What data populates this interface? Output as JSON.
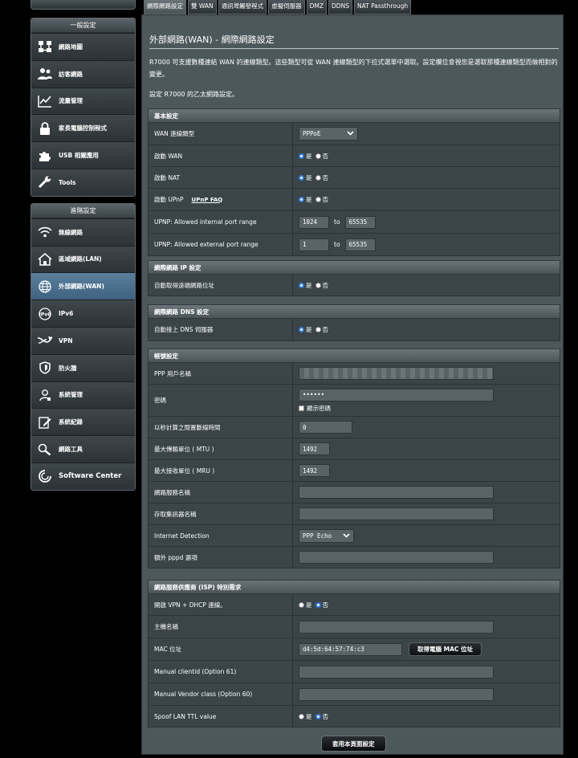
{
  "sidebar": {
    "general_title": "一般設定",
    "general_items": [
      {
        "label": "網路地圖"
      },
      {
        "label": "訪客網路"
      },
      {
        "label": "流量管理"
      },
      {
        "label": "家長電腦控制程式"
      },
      {
        "label": "USB 相關應用"
      },
      {
        "label": "Tools"
      }
    ],
    "advanced_title": "進階設定",
    "advanced_items": [
      {
        "label": "無線網路"
      },
      {
        "label": "區域網路(LAN)"
      },
      {
        "label": "外部網路(WAN)"
      },
      {
        "label": "IPv6"
      },
      {
        "label": "VPN"
      },
      {
        "label": "防火牆"
      },
      {
        "label": "系統管理"
      },
      {
        "label": "系統紀錄"
      },
      {
        "label": "網路工具"
      },
      {
        "label": "Software Center"
      }
    ]
  },
  "tabs": [
    "網際網路設定",
    "雙 WAN",
    "通訊埠觸發程式",
    "虛擬伺服器",
    "DMZ",
    "DDNS",
    "NAT Passthrough"
  ],
  "page": {
    "title": "外部網路(WAN) - 網際網路設定",
    "intro": "R7000 可支援數種連結 WAN 的連線類型。這些類型可從 WAN 連線類型的下拉式選單中選取。設定欄位會視您是選取那種連線類型而做相對的變更。",
    "intro2": "設定 R7000 的乙太網路設定。",
    "apply_label": "套用本頁面設定"
  },
  "radio": {
    "yes": "是",
    "no": "否"
  },
  "basic": {
    "title": "基本設定",
    "wan_type_label": "WAN 連線類型",
    "wan_type_value": "PPPoE",
    "enable_wan_label": "啟動 WAN",
    "enable_nat_label": "啟動 NAT",
    "enable_upnp_label": "啟動 UPnP",
    "upnp_faq": "UPnP FAQ",
    "int_port_label": "UPNP: Allowed internal port range",
    "int_port_from": "1024",
    "int_port_to": "65535",
    "ext_port_label": "UPNP: Allowed external port range",
    "ext_port_from": "1",
    "ext_port_to": "65535",
    "to": "to"
  },
  "wan_ip": {
    "title": "網際網路 IP 設定",
    "auto_ip_label": "自動取得遠端網路位址"
  },
  "wan_dns": {
    "title": "網際網路 DNS 設定",
    "auto_dns_label": "自動接上 DNS 伺服器"
  },
  "account": {
    "title": "帳號設定",
    "user_label": "PPP 用戶名稱",
    "pass_label": "密碼",
    "pass_value": "••••••",
    "show_pass": "顯示密碼",
    "idle_label": "以秒計算之閒置斷線時間",
    "idle_value": "0",
    "mtu_label": "最大傳輸單位 ( MTU )",
    "mtu_value": "1492",
    "mru_label": "最大接收單位 ( MRU )",
    "mru_value": "1492",
    "service_label": "網路服務名稱",
    "ac_label": "存取集訊器名稱",
    "detect_label": "Internet Detection",
    "detect_value": "PPP Echo",
    "pppd_label": "額外 pppd 選項"
  },
  "isp": {
    "title": "網路服務供應商 (ISP) 特別需求",
    "vpn_dhcp_label": "開啟 VPN + DHCP 連線。",
    "host_label": "主機名稱",
    "mac_label": "MAC 位址",
    "mac_value": "d4:5d:64:57:74:c3",
    "clone_mac": "取得電腦 MAC 位址",
    "opt61_label": "Manual clientid (Option 61)",
    "opt60_label": "Manual Vendor class (Option 60)",
    "ttl_label": "Spoof LAN TTL value"
  },
  "colors": {
    "accent": "#2d7be3",
    "panel": "#4d585c",
    "row": "#3b4548"
  }
}
